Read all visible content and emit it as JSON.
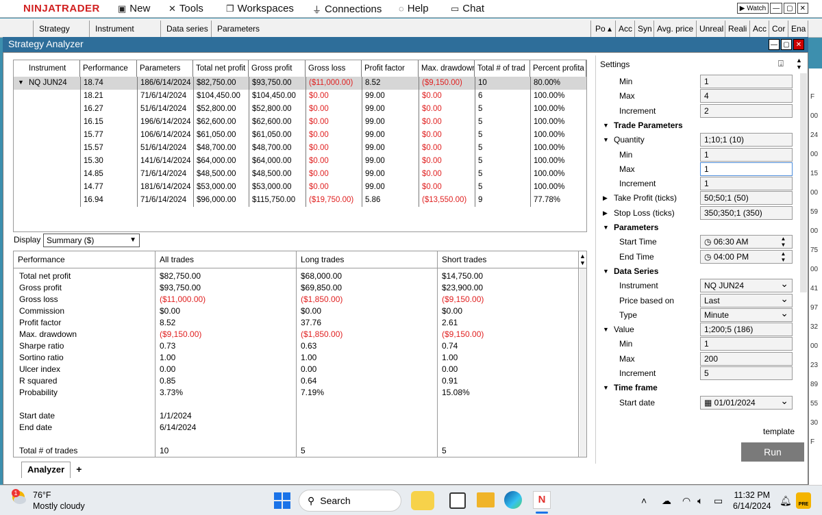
{
  "app": {
    "logo": "NINJATRADER",
    "menu": [
      {
        "icon": "new-icon",
        "label": "New"
      },
      {
        "icon": "tools-icon",
        "label": "Tools"
      },
      {
        "icon": "workspaces-icon",
        "label": "Workspaces"
      },
      {
        "icon": "connections-icon",
        "label": "Connections"
      },
      {
        "icon": "help-icon",
        "label": "Help"
      },
      {
        "icon": "chat-icon",
        "label": "Chat"
      }
    ],
    "watch_label": "Watch"
  },
  "tabstrip": {
    "left": [
      "Strategy",
      "Instrument",
      "Data series",
      "Parameters"
    ],
    "right": [
      "Po",
      "Acc",
      "Syn",
      "Avg. price",
      "Unreal",
      "Reali",
      "Acc",
      "Cor",
      "Ena"
    ]
  },
  "window": {
    "title": "Strategy Analyzer"
  },
  "results": {
    "headers": [
      "Instrument",
      "Performance",
      "Parameters",
      "Total net profit",
      "Gross profit",
      "Gross loss",
      "Profit factor",
      "Max. drawdown",
      "Total # of trad",
      "Percent profita"
    ],
    "rows": [
      [
        "NQ JUN24",
        "18.74",
        "186/6/14/2024",
        "$82,750.00",
        "$93,750.00",
        "($11,000.00)",
        "8.52",
        "($9,150.00)",
        "10",
        "80.00%"
      ],
      [
        "",
        "18.21",
        "71/6/14/2024",
        "$104,450.00",
        "$104,450.00",
        "$0.00",
        "99.00",
        "$0.00",
        "6",
        "100.00%"
      ],
      [
        "",
        "16.27",
        "51/6/14/2024",
        "$52,800.00",
        "$52,800.00",
        "$0.00",
        "99.00",
        "$0.00",
        "5",
        "100.00%"
      ],
      [
        "",
        "16.15",
        "196/6/14/2024",
        "$62,600.00",
        "$62,600.00",
        "$0.00",
        "99.00",
        "$0.00",
        "5",
        "100.00%"
      ],
      [
        "",
        "15.77",
        "106/6/14/2024",
        "$61,050.00",
        "$61,050.00",
        "$0.00",
        "99.00",
        "$0.00",
        "5",
        "100.00%"
      ],
      [
        "",
        "15.57",
        "51/6/14/2024",
        "$48,700.00",
        "$48,700.00",
        "$0.00",
        "99.00",
        "$0.00",
        "5",
        "100.00%"
      ],
      [
        "",
        "15.30",
        "141/6/14/2024",
        "$64,000.00",
        "$64,000.00",
        "$0.00",
        "99.00",
        "$0.00",
        "5",
        "100.00%"
      ],
      [
        "",
        "14.85",
        "71/6/14/2024",
        "$48,500.00",
        "$48,500.00",
        "$0.00",
        "99.00",
        "$0.00",
        "5",
        "100.00%"
      ],
      [
        "",
        "14.77",
        "181/6/14/2024",
        "$53,000.00",
        "$53,000.00",
        "$0.00",
        "99.00",
        "$0.00",
        "5",
        "100.00%"
      ],
      [
        "",
        "16.94",
        "71/6/14/2024",
        "$96,000.00",
        "$115,750.00",
        "($19,750.00)",
        "5.86",
        "($13,550.00)",
        "9",
        "77.78%"
      ]
    ]
  },
  "display": {
    "label": "Display",
    "value": "Summary ($)"
  },
  "summary": {
    "headers": [
      "Performance",
      "All trades",
      "Long trades",
      "Short trades"
    ],
    "labels": [
      "Total net profit",
      "Gross profit",
      "Gross loss",
      "Commission",
      "Profit factor",
      "Max. drawdown",
      "Sharpe ratio",
      "Sortino ratio",
      "Ulcer index",
      "R squared",
      "Probability"
    ],
    "all": [
      "$82,750.00",
      "$93,750.00",
      "($11,000.00)",
      "$0.00",
      "8.52",
      "($9,150.00)",
      "0.73",
      "1.00",
      "0.00",
      "0.85",
      "3.73%"
    ],
    "long": [
      "$68,000.00",
      "$69,850.00",
      "($1,850.00)",
      "$0.00",
      "37.76",
      "($1,850.00)",
      "0.63",
      "1.00",
      "0.00",
      "0.64",
      "7.19%"
    ],
    "short": [
      "$14,750.00",
      "$23,900.00",
      "($9,150.00)",
      "$0.00",
      "2.61",
      "($9,150.00)",
      "0.74",
      "1.00",
      "0.00",
      "0.91",
      "15.08%"
    ],
    "start_label": "Start date",
    "end_label": "End date",
    "start_date": "1/1/2024",
    "end_date": "6/14/2024",
    "trades_label": "Total # of trades",
    "trades_all": "10",
    "trades_long": "5",
    "trades_short": "5"
  },
  "bottom_tabs": {
    "active": "Analyzer",
    "add": "+"
  },
  "settings": {
    "title": "Settings",
    "rows": [
      {
        "label": "Min",
        "value": "1",
        "kind": "field"
      },
      {
        "label": "Max",
        "value": "4",
        "kind": "field"
      },
      {
        "label": "Increment",
        "value": "2",
        "kind": "field"
      },
      {
        "label": "Trade Parameters",
        "value": "",
        "kind": "section"
      },
      {
        "label": "Quantity",
        "value": "1;10;1 (10)",
        "kind": "expandable"
      },
      {
        "label": "Min",
        "value": "1",
        "kind": "field"
      },
      {
        "label": "Max",
        "value": "1",
        "kind": "field"
      },
      {
        "label": "Increment",
        "value": "1",
        "kind": "field"
      },
      {
        "label": "Take Profit (ticks)",
        "value": "50;50;1 (50)",
        "kind": "collapsed"
      },
      {
        "label": "Stop Loss (ticks)",
        "value": "350;350;1 (350)",
        "kind": "collapsed"
      },
      {
        "label": "Parameters",
        "value": "",
        "kind": "section"
      },
      {
        "label": "Start Time",
        "value": "06:30 AM",
        "kind": "time"
      },
      {
        "label": "End Time",
        "value": "04:00 PM",
        "kind": "time"
      },
      {
        "label": "Data Series",
        "value": "",
        "kind": "section"
      },
      {
        "label": "Instrument",
        "value": "NQ JUN24",
        "kind": "select"
      },
      {
        "label": "Price based on",
        "value": "Last",
        "kind": "select"
      },
      {
        "label": "Type",
        "value": "Minute",
        "kind": "select"
      },
      {
        "label": "Value",
        "value": "1;200;5 (186)",
        "kind": "expandable"
      },
      {
        "label": "Min",
        "value": "1",
        "kind": "field"
      },
      {
        "label": "Max",
        "value": "200",
        "kind": "field"
      },
      {
        "label": "Increment",
        "value": "5",
        "kind": "field"
      },
      {
        "label": "Time frame",
        "value": "",
        "kind": "section"
      },
      {
        "label": "Start date",
        "value": "01/01/2024",
        "kind": "date"
      }
    ],
    "template_label": "template",
    "run_label": "Run"
  },
  "taskbar": {
    "temp": "76°F",
    "weather": "Mostly cloudy",
    "notification_count": "1",
    "search": "Search",
    "time": "11:32 PM",
    "date": "6/14/2024",
    "badge": "PRE"
  },
  "right_strip": [
    "F",
    "00",
    "24",
    "00",
    "15",
    "00",
    "59",
    "00",
    "75",
    "00",
    "41",
    "97",
    "32",
    "00",
    "23",
    "89",
    "55",
    "30",
    "F"
  ]
}
